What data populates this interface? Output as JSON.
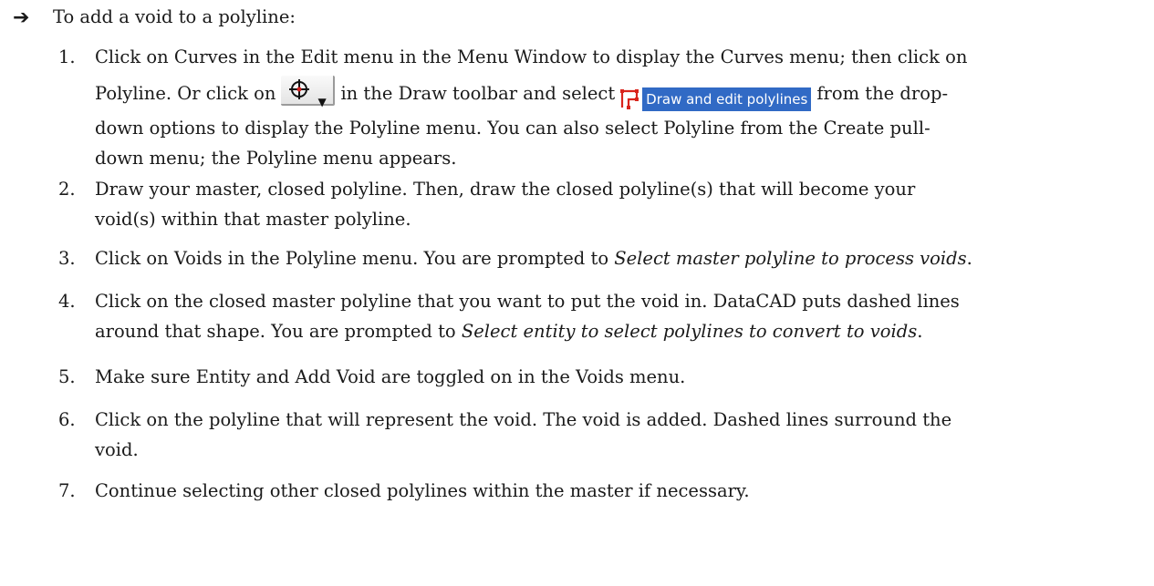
{
  "heading": "To add a void to a polyline:",
  "steps": [
    {
      "number": "1.",
      "line1": "Click on Curves in the Edit menu in the Menu Window to display the Curves menu; then click on",
      "line2_before_button": "Polyline. Or click on",
      "line2_between": "in the Draw toolbar and select",
      "menu_option_label": "Draw and edit polylines",
      "line2_after": "from the drop-",
      "line3": "down options to display the Polyline menu. You can also select Polyline from the Create pull-",
      "line4": "down menu; the Polyline menu appears."
    },
    {
      "number": "2.",
      "line1": "Draw your master, closed polyline. Then, draw the closed polyline(s) that will become your",
      "line2": "void(s) within that master polyline."
    },
    {
      "number": "3.",
      "text": "Click on Voids in the Polyline menu. You are prompted to ",
      "prompt": "Select master polyline to process voids",
      "end": "."
    },
    {
      "number": "4.",
      "line1": "Click on the closed master polyline that you want to put the void in. DataCAD puts dashed lines",
      "line2_text": "around that shape. You are prompted to ",
      "line2_prompt": "Select entity to select polylines to convert to voids",
      "line2_end": "."
    },
    {
      "number": "5.",
      "text": "Make sure Entity and Add Void are toggled on in the Voids menu."
    },
    {
      "number": "6.",
      "line1": "Click on the polyline that will represent the void. The void is added. Dashed lines surround the",
      "line2": "void."
    },
    {
      "number": "7.",
      "text": "Continue selecting other closed polylines within the master if necessary."
    }
  ],
  "icons": {
    "heading_arrow": "right-arrow-icon",
    "toolbar_button": "crosshair-dropdown-icon",
    "menu_option": "polyline-icon"
  },
  "colors": {
    "menu_highlight": "#316ac5",
    "polyline_icon_red": "#d9241c"
  }
}
